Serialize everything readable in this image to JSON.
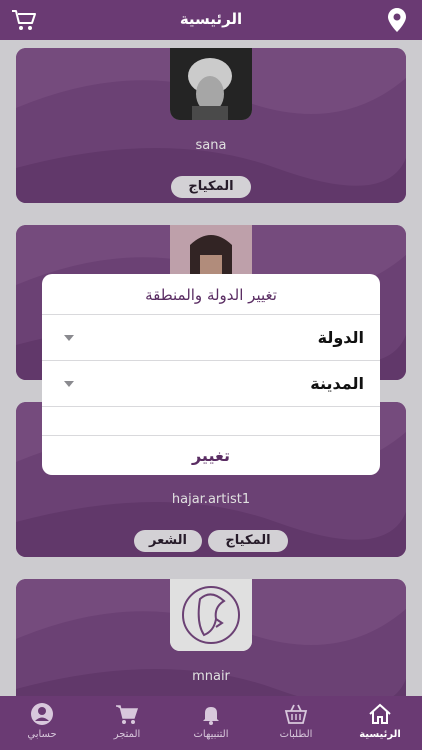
{
  "header": {
    "title": "الرئيسية"
  },
  "cards": [
    {
      "username": "sana",
      "tags": [
        "المكياج"
      ]
    },
    {
      "username": "",
      "tags": []
    },
    {
      "username": "hajar.artist1",
      "tags": [
        "المكياج",
        "الشعر"
      ]
    },
    {
      "username": "mnair",
      "tags": []
    }
  ],
  "dialog": {
    "title": "تغيير الدولة والمنطقة",
    "country_label": "الدولة",
    "city_label": "المدينة",
    "submit_label": "تغيير"
  },
  "tabs": [
    {
      "label": "الرئيسية",
      "icon": "home-icon",
      "active": true
    },
    {
      "label": "الطلبات",
      "icon": "basket-icon",
      "active": false
    },
    {
      "label": "التنبيهات",
      "icon": "bell-icon",
      "active": false
    },
    {
      "label": "المتجر",
      "icon": "cart-icon",
      "active": false
    },
    {
      "label": "حسابي",
      "icon": "user-icon",
      "active": false
    }
  ],
  "colors": {
    "primary": "#6a3a73",
    "card": "#7a4a84",
    "accent_text": "#5a2d63"
  }
}
